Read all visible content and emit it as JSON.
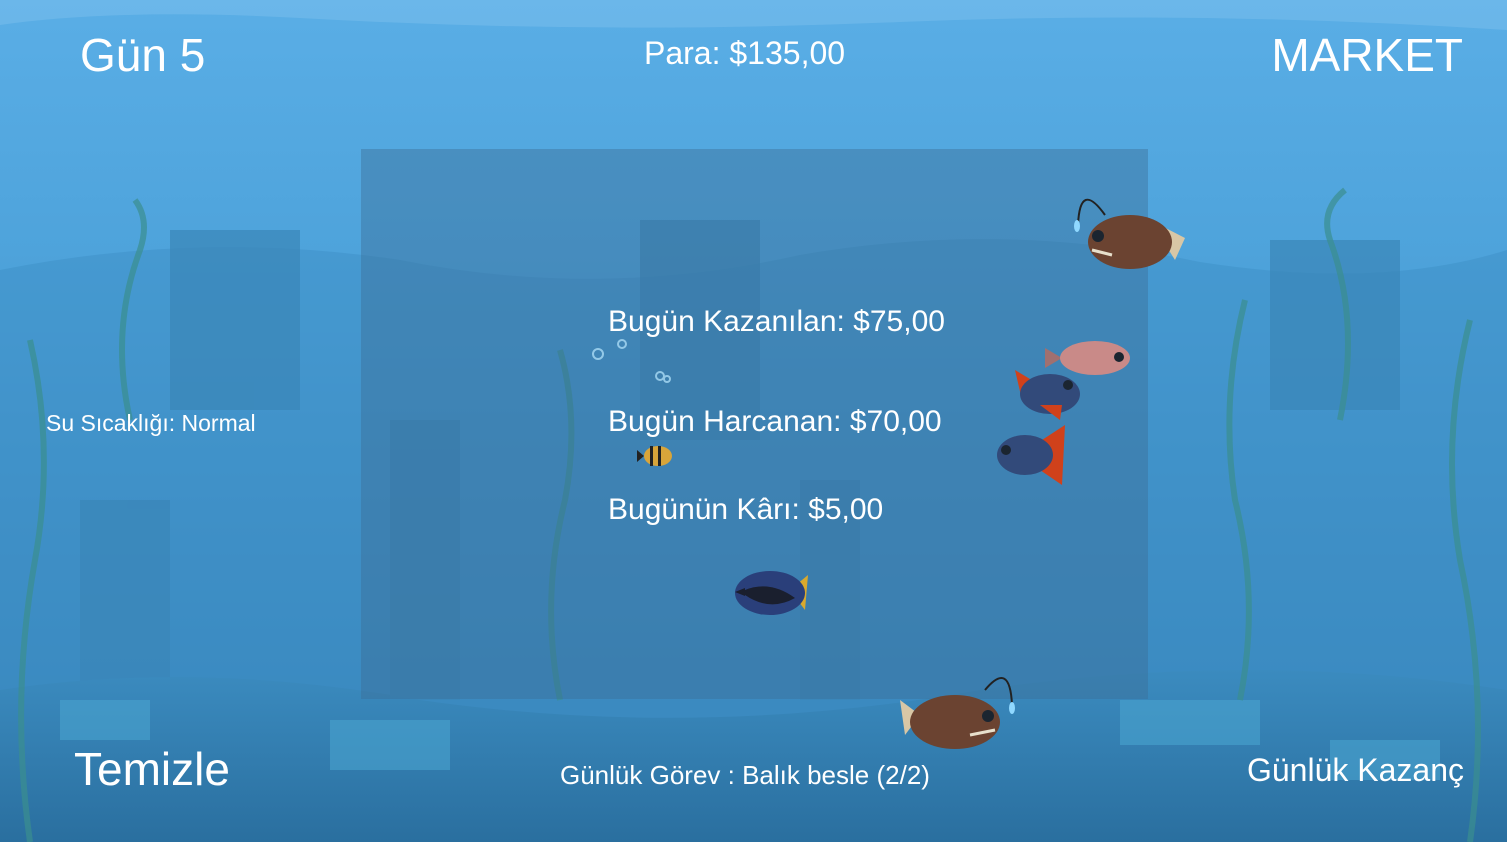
{
  "hud": {
    "day": "Gün 5",
    "money": "Para: $135,00",
    "market_button": "MARKET",
    "water_temperature": "Su Sıcaklığı: Normal",
    "clean_button": "Temizle",
    "daily_task": "Günlük Görev : Balık besle (2/2)",
    "daily_earnings_button": "Günlük Kazanç"
  },
  "summary": {
    "earned": "Bugün Kazanılan: $75,00",
    "spent": "Bugün Harcanan: $70,00",
    "profit": "Bugünün Kârı: $5,00"
  },
  "fish": [
    "anglerfish",
    "pink-fish",
    "red-blue-fish",
    "red-blue-fish",
    "bumblebee-fish",
    "blue-tang-fish",
    "anglerfish"
  ],
  "colors": {
    "water_top": "#5aaee6",
    "water_bottom": "#2f78ad",
    "text": "#ffffff"
  }
}
